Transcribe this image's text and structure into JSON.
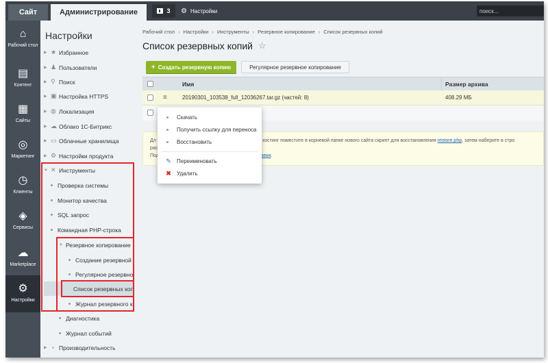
{
  "topbar": {
    "site_tab": "Сайт",
    "admin_tab": "Администрирование",
    "notifications_count": "3",
    "settings_label": "Настройки",
    "search_placeholder": "поиск..."
  },
  "iconbar": [
    {
      "label": "Рабочий стол",
      "icon": "home-icon"
    },
    {
      "label": "Контент",
      "icon": "document-icon"
    },
    {
      "label": "Сайты",
      "icon": "calendar-icon"
    },
    {
      "label": "Маркетинг",
      "icon": "target-icon"
    },
    {
      "label": "Клиенты",
      "icon": "clock-24-icon"
    },
    {
      "label": "Сервисы",
      "icon": "layers-icon"
    },
    {
      "label": "Marketplace",
      "icon": "cloud-download-icon"
    },
    {
      "label": "Настройки",
      "icon": "gear-icon",
      "active": true
    }
  ],
  "menu": {
    "title": "Настройки",
    "items": [
      {
        "label": "Избранное",
        "icon": "star-icon"
      },
      {
        "label": "Пользователи",
        "icon": "user-icon"
      },
      {
        "label": "Поиск",
        "icon": "search-icon"
      },
      {
        "label": "Настройка HTTPS",
        "icon": "lock-icon"
      },
      {
        "label": "Локализация",
        "icon": "globe-icon"
      },
      {
        "label": "Облако 1С-Битрикс",
        "icon": "cloud-icon"
      },
      {
        "label": "Облачные хранилища",
        "icon": "storage-icon"
      },
      {
        "label": "Настройки продукта",
        "icon": "settings-icon"
      },
      {
        "label": "Инструменты",
        "icon": "tools-icon"
      },
      {
        "label": "Проверка системы"
      },
      {
        "label": "Монитор качества"
      },
      {
        "label": "SQL запрос"
      },
      {
        "label": "Командная PHP-строка"
      },
      {
        "label": "Резервное копирование"
      },
      {
        "label": "Создание резервной ко"
      },
      {
        "label": "Регулярное резервное"
      },
      {
        "label": "Список резервных копи"
      },
      {
        "label": "Журнал резервного коп"
      },
      {
        "label": "Диагностика"
      },
      {
        "label": "Журнал событий"
      },
      {
        "label": "Производительность"
      }
    ]
  },
  "content": {
    "breadcrumb": [
      "Рабочий стол",
      "Настройки",
      "Инструменты",
      "Резервное копирование",
      "Список резервных копий"
    ],
    "page_title": "Список резервных копий",
    "create_button": "Создать резервную копию",
    "regular_button": "Регулярное резервное копирование",
    "table": {
      "col_name": "Имя",
      "col_size": "Размер архива",
      "rows": [
        {
          "name": "20190301_103538_full_12036267.tar.gz (частей: 8)",
          "size": "408.29 МБ"
        }
      ]
    },
    "info": {
      "l1": "Дл",
      "r1": "й хостинг поместите в корневой папке нового сайта скрипт для восстановления",
      "r1_link": "restore.php",
      "r1_tail": ", затем наберите в стро",
      "l2": "рас",
      "l3": "Под",
      "r3_link": "равки",
      "r3_tail": "."
    }
  },
  "popup": {
    "download": "Скачать",
    "get_link": "Получить ссылку для переноса",
    "restore": "Восстановить",
    "rename": "Переименовать",
    "delete": "Удалить"
  }
}
